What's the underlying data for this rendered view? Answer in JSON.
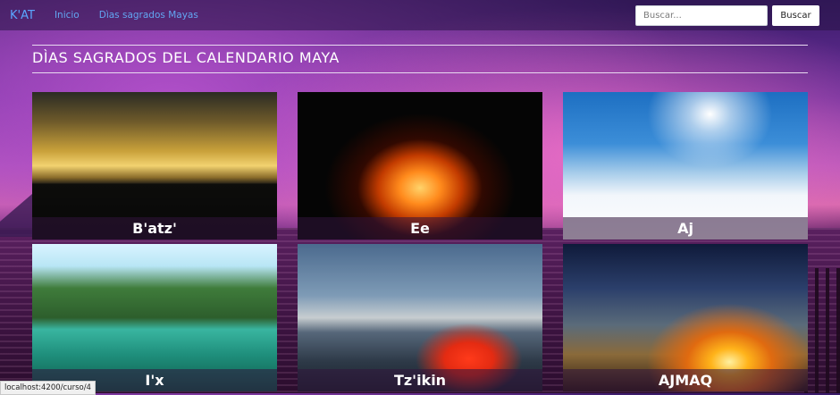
{
  "navbar": {
    "brand": "K'AT",
    "links": [
      "Inicio",
      "Dìas sagrados Mayas"
    ],
    "search": {
      "placeholder": "Buscar...",
      "value": "",
      "button": "Buscar"
    }
  },
  "page": {
    "title": "DÌAS SAGRADOS DEL CALENDARIO MAYA"
  },
  "cards": [
    {
      "label": "B'atz'",
      "image": "sunset-over-hills"
    },
    {
      "label": "Ee",
      "image": "bonfire-at-night"
    },
    {
      "label": "Aj",
      "image": "sky-above-clouds"
    },
    {
      "label": "I'x",
      "image": "turquoise-mountain-lake"
    },
    {
      "label": "Tz'ikin",
      "image": "red-tent-on-mountain"
    },
    {
      "label": "AJMAQ",
      "image": "sunset-with-clouds"
    }
  ],
  "status_bar": {
    "url": "localhost:4200/curso/4"
  }
}
